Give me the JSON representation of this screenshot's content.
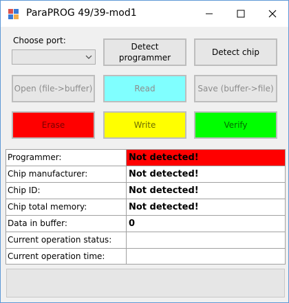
{
  "window": {
    "title": "ParaPROG 49/39-mod1"
  },
  "controls": {
    "port_label": "Choose port:",
    "port_value": "",
    "detect_programmer": [
      "Detect",
      "programmer"
    ],
    "detect_chip": "Detect chip",
    "open": "Open (file->buffer)",
    "read": "Read",
    "save": "Save (buffer->file)",
    "erase": "Erase",
    "write": "Write",
    "verify": "Verify"
  },
  "colors": {
    "read": "#80ffff",
    "erase": "#ff0000",
    "write": "#ffff00",
    "verify": "#00ff00",
    "programmer_status": "#ff0000"
  },
  "info": [
    {
      "label": "Programmer:",
      "value": "Not detected!"
    },
    {
      "label": "Chip manufacturer:",
      "value": "Not detected!"
    },
    {
      "label": "Chip ID:",
      "value": "Not detected!"
    },
    {
      "label": "Chip total memory:",
      "value": "Not detected!"
    },
    {
      "label": "Data in buffer:",
      "value": "0"
    },
    {
      "label": "Current operation status:",
      "value": ""
    },
    {
      "label": "Current operation time:",
      "value": ""
    }
  ],
  "status_bar": {
    "text": ""
  }
}
